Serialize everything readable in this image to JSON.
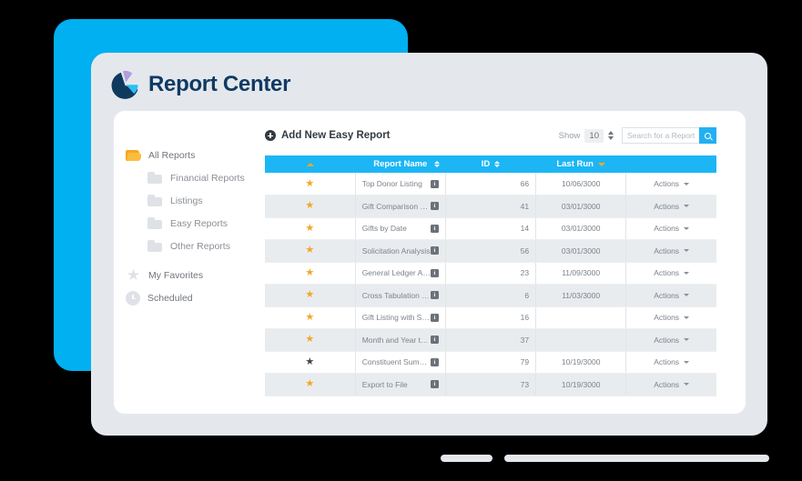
{
  "brand": {
    "title": "Report Center",
    "logo_icon": "pie-chart-icon",
    "logo_colors": {
      "navy": "#103A5D",
      "cyan": "#29C1F5",
      "purple": "#B39DE0"
    }
  },
  "theme": {
    "background": "#000000",
    "backdrop_panel": "#00B0F0",
    "device_frame": "#E4E8ED",
    "card": "#FFFFFF",
    "table_header": "#1CB6F5",
    "accent_orange": "#F5A623",
    "text_muted": "#7D838A"
  },
  "sidebar": {
    "items": [
      {
        "label": "All Reports",
        "icon": "folder-open-icon",
        "level": 0
      },
      {
        "label": "Financial Reports",
        "icon": "folder-closed-icon",
        "level": 1
      },
      {
        "label": "Listings",
        "icon": "folder-closed-icon",
        "level": 1
      },
      {
        "label": "Easy Reports",
        "icon": "folder-closed-icon",
        "level": 1
      },
      {
        "label": "Other Reports",
        "icon": "folder-closed-icon",
        "level": 1
      },
      {
        "label": "My  Favorites",
        "icon": "star-icon",
        "level": 0
      },
      {
        "label": "Scheduled",
        "icon": "clock-icon",
        "level": 0
      }
    ]
  },
  "toolbar": {
    "add_report_label": "Add New Easy Report",
    "add_report_icon": "plus-circle-icon",
    "show_label": "Show",
    "show_value": "10",
    "search_placeholder": "Search for a Report",
    "search_value": "",
    "search_icon": "magnifier-icon"
  },
  "table": {
    "columns": [
      {
        "key": "favorite",
        "label": "",
        "sort": "asc-active"
      },
      {
        "key": "name",
        "label": "Report Name",
        "sort": "both"
      },
      {
        "key": "id",
        "label": "ID",
        "sort": "both"
      },
      {
        "key": "last_run",
        "label": "Last Run",
        "sort": "desc-active"
      },
      {
        "key": "actions",
        "label": "",
        "sort": "none"
      }
    ],
    "actions_label": "Actions",
    "info_glyph": "i",
    "rows": [
      {
        "favorite": "orange",
        "name": "Top Donor Listing",
        "id": "66",
        "last_run": "10/06/3000"
      },
      {
        "favorite": "orange",
        "name": "Gift Comparison by Time Period",
        "id": "41",
        "last_run": "03/01/3000"
      },
      {
        "favorite": "orange",
        "name": "Gifts by Date",
        "id": "14",
        "last_run": "03/01/3000"
      },
      {
        "favorite": "orange",
        "name": "Solicitation Analysis",
        "id": "56",
        "last_run": "03/01/3000"
      },
      {
        "favorite": "orange",
        "name": "General Ledger Analysis",
        "id": "23",
        "last_run": "11/09/3000"
      },
      {
        "favorite": "orange",
        "name": "Cross Tabulation Report",
        "id": "6",
        "last_run": "11/03/3000"
      },
      {
        "favorite": "orange",
        "name": "Gift Listing with Soft Credits",
        "id": "16",
        "last_run": ""
      },
      {
        "favorite": "orange",
        "name": "Month and Year to Date Summary (Calendar)",
        "id": "37",
        "last_run": ""
      },
      {
        "favorite": "dark",
        "name": "Constituent Summary",
        "id": "79",
        "last_run": "10/19/3000"
      },
      {
        "favorite": "orange",
        "name": "Export to File",
        "id": "73",
        "last_run": "10/19/3000"
      }
    ]
  }
}
